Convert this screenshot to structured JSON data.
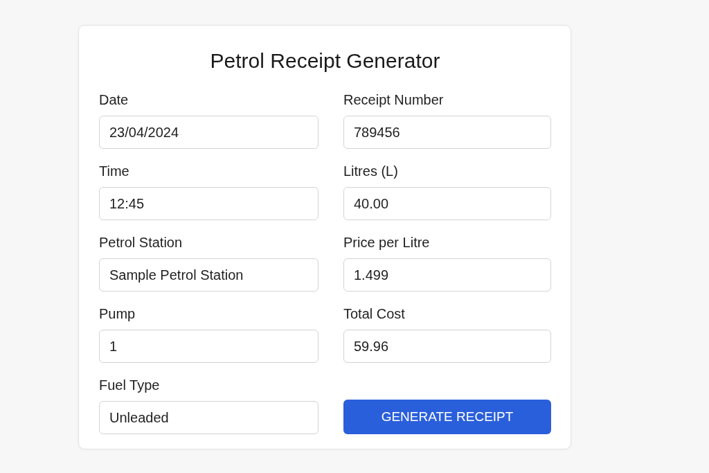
{
  "title": "Petrol Receipt Generator",
  "fields": [
    {
      "label": "Date",
      "value": "23/04/2024"
    },
    {
      "label": "Receipt Number",
      "value": "789456"
    },
    {
      "label": "Time",
      "value": "12:45"
    },
    {
      "label": "Litres (L)",
      "value": "40.00"
    },
    {
      "label": "Petrol Station",
      "value": "Sample Petrol Station"
    },
    {
      "label": "Price per Litre",
      "value": "1.499"
    },
    {
      "label": "Pump",
      "value": "1"
    },
    {
      "label": "Total Cost",
      "value": "59.96"
    },
    {
      "label": "Fuel Type",
      "value": "Unleaded"
    }
  ],
  "button": {
    "label": "GENERATE RECEIPT"
  }
}
